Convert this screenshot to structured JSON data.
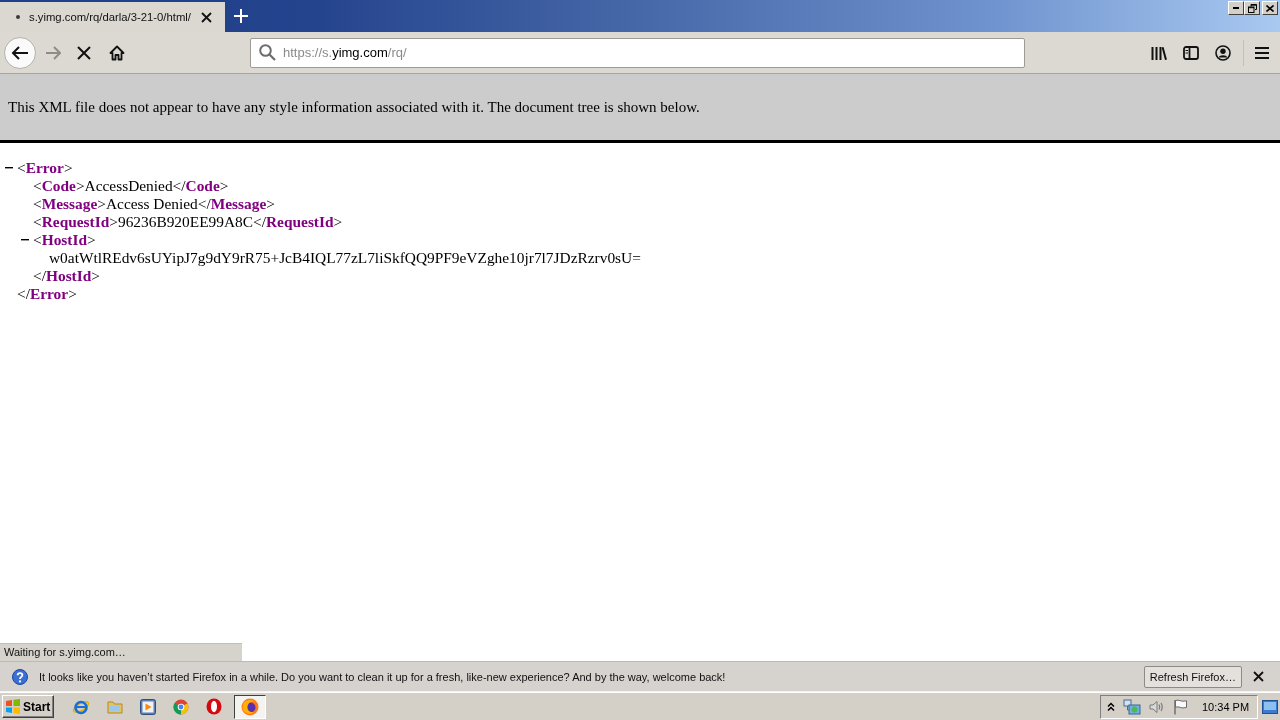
{
  "tabs": [
    {
      "title": "s.yimg.com/rq/darla/3-21-0/html/",
      "selected": true,
      "loading": true
    }
  ],
  "navigation": {
    "forward_disabled": true,
    "loading": true
  },
  "address_bar": {
    "segments": [
      {
        "text": "https://s.",
        "highlight": false
      },
      {
        "text": "yimg.com",
        "highlight": true
      },
      {
        "text": "/rq/",
        "highlight": false
      }
    ]
  },
  "xml_notice": "This XML file does not appear to have any style information associated with it. The document tree is shown below.",
  "document_tree": [
    {
      "open": "<**Error**>",
      "expanded": true,
      "children": [
        {
          "line": "<**Code**>AccessDenied</**Code**>"
        },
        {
          "line": "<**Message**>Access Denied</**Message**>"
        },
        {
          "line": "<**RequestId**>96236B920EE99A8C</**RequestId**>"
        },
        {
          "open": "<**HostId**>",
          "expanded": true,
          "children": [
            {
              "line": "w0atWtlREdv6sUYipJ7g9dY9rR75+JcB4IQL77zL7liSkfQQ9PF9eVZghe10jr7l7JDzRzrv0sU="
            }
          ],
          "close": "</**HostId**>"
        }
      ],
      "close": "</**Error**>"
    }
  ],
  "status": "Waiting for s.yimg.com…",
  "notification": {
    "message": "It looks like you haven’t started Firefox in a while. Do you want to clean it up for a fresh, like-new experience? And by the way, welcome back!",
    "button": "Refresh Firefox…"
  },
  "taskbar": {
    "start": "Start",
    "task_button": {
      "selected": true
    },
    "clock": "10:34 PM"
  }
}
